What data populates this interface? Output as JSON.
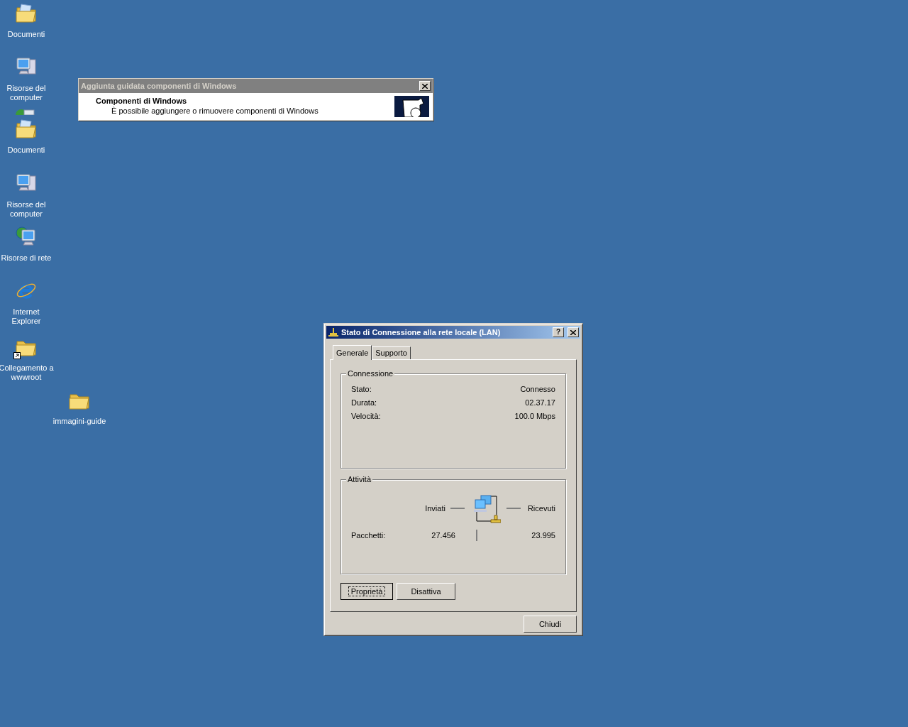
{
  "desktop_icons": [
    {
      "kind": "documents",
      "label": "Documenti",
      "shortcut": false
    },
    {
      "kind": "computer",
      "label": "Risorse del computer",
      "shortcut": false
    },
    {
      "kind": "documents",
      "label": "Documenti",
      "shortcut": false
    },
    {
      "kind": "computer",
      "label": "Risorse del computer",
      "shortcut": false
    },
    {
      "kind": "network",
      "label": "Risorse di rete",
      "shortcut": false
    },
    {
      "kind": "browser",
      "label": "Internet Explorer",
      "shortcut": false
    },
    {
      "kind": "folder",
      "label": "Collegamento a wwwroot",
      "shortcut": true
    },
    {
      "kind": "folder",
      "label": "immagini-guide",
      "shortcut": false
    }
  ],
  "background_window": {
    "title": "Aggiunta guidata componenti di Windows",
    "heading": "Componenti di Windows",
    "subtitle": "È possibile aggiungere o rimuovere componenti di Windows"
  },
  "dialog": {
    "title": "Stato di Connessione alla rete locale (LAN)",
    "help_button": "?",
    "tabs": [
      {
        "label": "Generale",
        "selected": true
      },
      {
        "label": "Supporto",
        "selected": false
      }
    ],
    "connection": {
      "title": "Connessione",
      "rows": [
        {
          "label": "Stato:",
          "value": "Connesso"
        },
        {
          "label": "Durata:",
          "value": "02.37.17"
        },
        {
          "label": "Velocità:",
          "value": "100.0 Mbps"
        }
      ]
    },
    "activity": {
      "title": "Attività",
      "sent_label": "Inviati",
      "received_label": "Ricevuti",
      "packets_label": "Pacchetti:",
      "sent": "27.456",
      "received": "23.995"
    },
    "buttons": [
      {
        "label": "Proprietà",
        "focused": true
      },
      {
        "label": "Disattiva",
        "focused": false
      }
    ],
    "close_button": "Chiudi"
  }
}
